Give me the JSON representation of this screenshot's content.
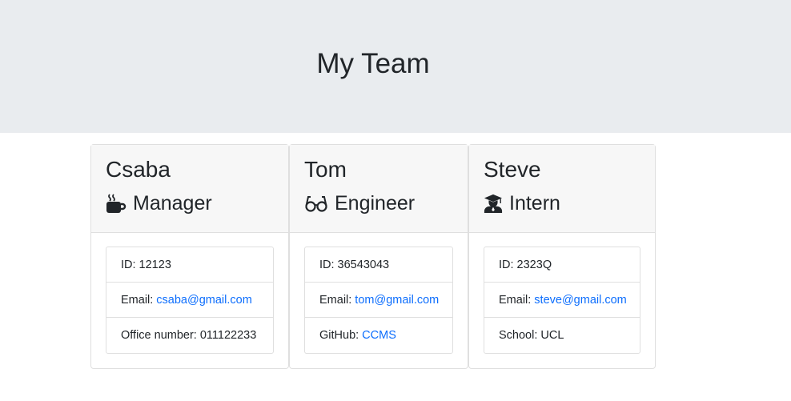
{
  "header": {
    "title": "My Team"
  },
  "cards": [
    {
      "name": "Csaba",
      "role": "Manager",
      "role_icon": "coffee-mug-icon",
      "id_label": "ID: 12123",
      "email_label": "Email:",
      "email": "csaba@gmail.com",
      "extra_label": "Office number: 011122233",
      "extra_link": ""
    },
    {
      "name": "Tom",
      "role": "Engineer",
      "role_icon": "glasses-icon",
      "id_label": "ID: 36543043",
      "email_label": "Email:",
      "email": "tom@gmail.com",
      "extra_label": "GitHub:",
      "extra_link": "CCMS"
    },
    {
      "name": "Steve",
      "role": "Intern",
      "role_icon": "graduate-icon",
      "id_label": "ID: 2323Q",
      "email_label": "Email:",
      "email": "steve@gmail.com",
      "extra_label": "School: UCL",
      "extra_link": ""
    }
  ],
  "colors": {
    "link": "#0d6efd",
    "jumbotron": "#e9ecef",
    "card_header": "#f7f7f7"
  }
}
